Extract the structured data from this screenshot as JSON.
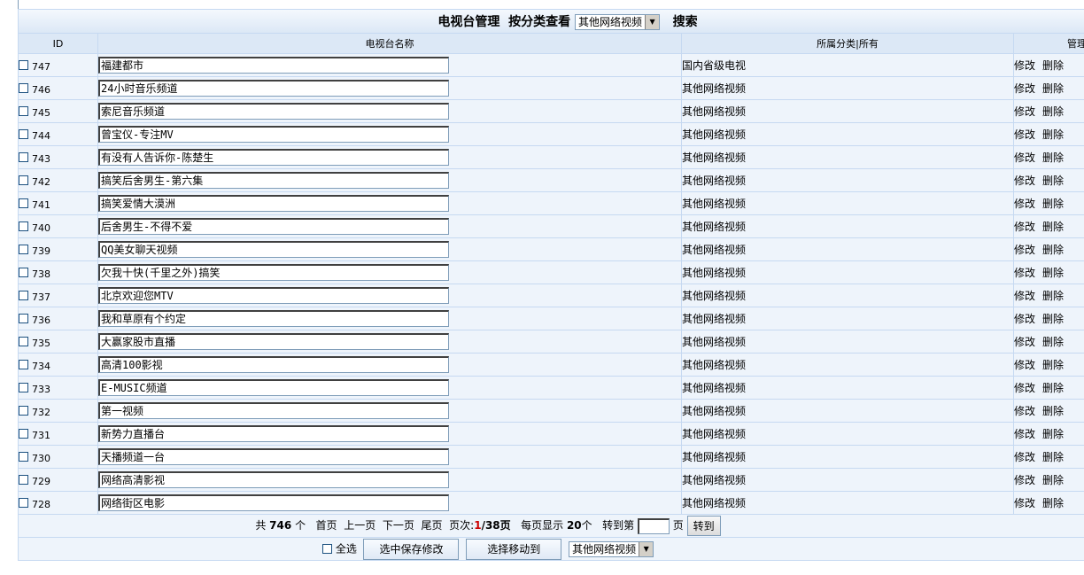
{
  "header": {
    "title": "电视台管理",
    "filter_label": "按分类查看",
    "category_select": "其他网络视频",
    "search_label": "搜索"
  },
  "columns": {
    "id": "ID",
    "name": "电视台名称",
    "category": "所属分类|所有",
    "manage": "管理"
  },
  "rows": [
    {
      "id": "747",
      "name": "福建都市",
      "category": "国内省级电视"
    },
    {
      "id": "746",
      "name": "24小时音乐频道",
      "category": "其他网络视频"
    },
    {
      "id": "745",
      "name": "索尼音乐频道",
      "category": "其他网络视频"
    },
    {
      "id": "744",
      "name": "曾宝仪-专注MV",
      "category": "其他网络视频"
    },
    {
      "id": "743",
      "name": "有没有人告诉你-陈楚生",
      "category": "其他网络视频"
    },
    {
      "id": "742",
      "name": "搞笑后舍男生-第六集",
      "category": "其他网络视频"
    },
    {
      "id": "741",
      "name": "搞笑爱情大漠洲",
      "category": "其他网络视频"
    },
    {
      "id": "740",
      "name": "后舍男生-不得不爱",
      "category": "其他网络视频"
    },
    {
      "id": "739",
      "name": "QQ美女聊天视频",
      "category": "其他网络视频"
    },
    {
      "id": "738",
      "name": "欠我十快(千里之外)搞笑",
      "category": "其他网络视频"
    },
    {
      "id": "737",
      "name": "北京欢迎您MTV",
      "category": "其他网络视频"
    },
    {
      "id": "736",
      "name": "我和草原有个约定",
      "category": "其他网络视频"
    },
    {
      "id": "735",
      "name": "大赢家股市直播",
      "category": "其他网络视频"
    },
    {
      "id": "734",
      "name": "高清100影视",
      "category": "其他网络视频"
    },
    {
      "id": "733",
      "name": "E-MUSIC频道",
      "category": "其他网络视频"
    },
    {
      "id": "732",
      "name": "第一视频",
      "category": "其他网络视频"
    },
    {
      "id": "731",
      "name": "新势力直播台",
      "category": "其他网络视频"
    },
    {
      "id": "730",
      "name": "天播频道一台",
      "category": "其他网络视频"
    },
    {
      "id": "729",
      "name": "网络高清影视",
      "category": "其他网络视频"
    },
    {
      "id": "728",
      "name": "网络街区电影",
      "category": "其他网络视频"
    }
  ],
  "actions": {
    "edit": "修改",
    "delete": "删除"
  },
  "pager": {
    "total_prefix": "共",
    "total": "746",
    "total_unit": "个",
    "first": "首页",
    "prev": "上一页",
    "next": "下一页",
    "last": "尾页",
    "page_label": "页次:",
    "current_page": "1",
    "total_pages": "/38页",
    "per_page_label": "每页显示",
    "per_page": "20",
    "per_page_unit": "个",
    "goto_label": "转到第",
    "goto_unit": "页",
    "goto_button": "转到"
  },
  "bottom": {
    "select_all": "全选",
    "save_button": "选中保存修改",
    "move_button": "选择移动到",
    "move_select": "其他网络视频"
  }
}
